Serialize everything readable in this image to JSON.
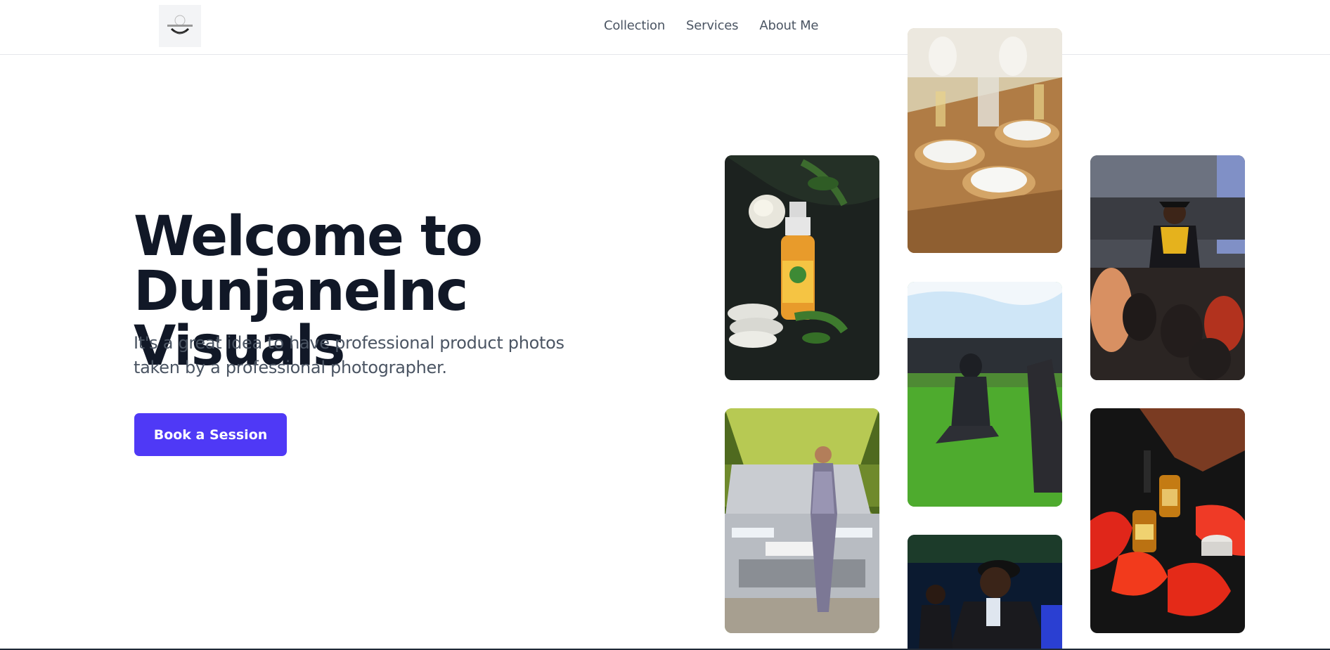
{
  "nav": {
    "items": [
      {
        "label": "Collection"
      },
      {
        "label": "Services"
      },
      {
        "label": "About Me"
      }
    ]
  },
  "hero": {
    "title_line1": "Welcome to",
    "title_line2": "DunjaneInc Visuals",
    "subtitle": "It's a great idea to have professional product photos taken by a professional photographer.",
    "cta_label": "Book a Session"
  },
  "gallery": {
    "tiles": [
      {
        "subject": "product-spray-bottle-photo"
      },
      {
        "subject": "car-fashion-portrait-photo"
      },
      {
        "subject": "table-setting-photo"
      },
      {
        "subject": "kneeling-on-grass-photo"
      },
      {
        "subject": "party-portrait-photo"
      },
      {
        "subject": "graduation-photo"
      },
      {
        "subject": "oil-bottle-rose-petals-photo"
      }
    ]
  },
  "colors": {
    "accent": "#4f39f6",
    "heading": "#111827",
    "body_text": "#4b5563"
  }
}
